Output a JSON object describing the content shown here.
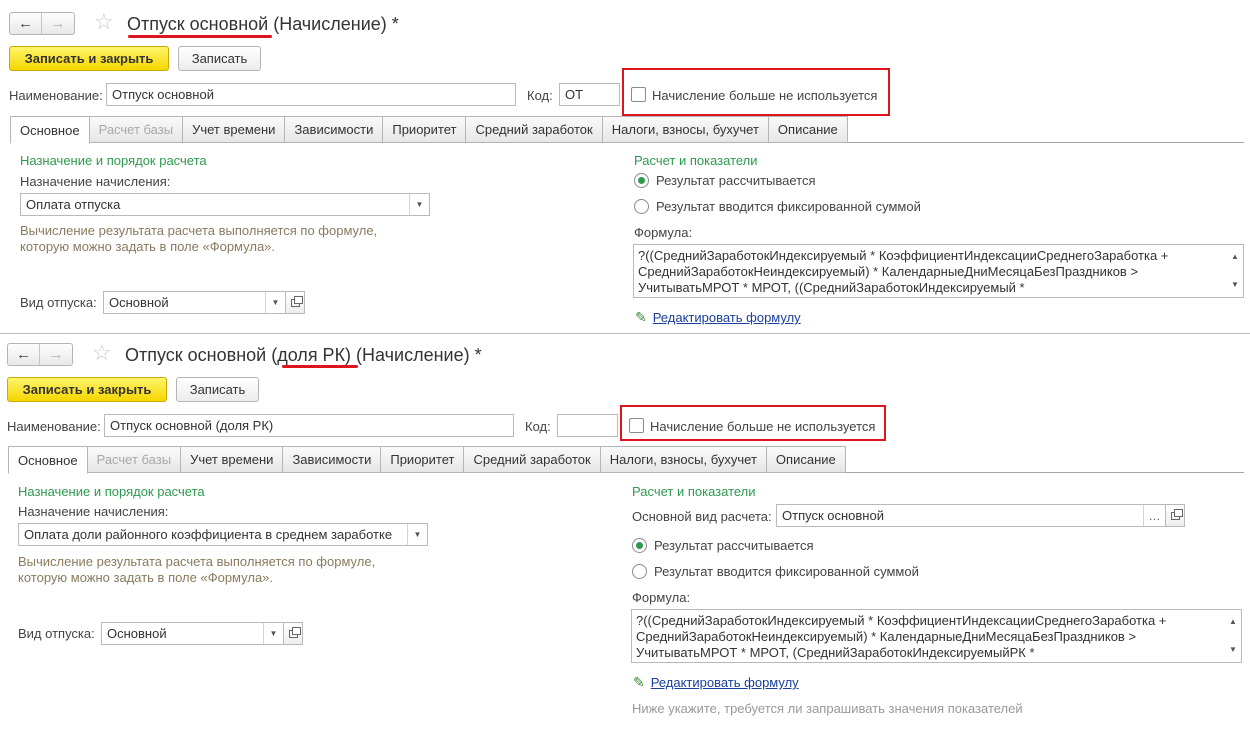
{
  "form1": {
    "title": "Отпуск основной (Начисление) *",
    "save_close": "Записать и закрыть",
    "save": "Записать",
    "name_label": "Наименование:",
    "name_value": "Отпуск основной",
    "code_label": "Код:",
    "code_value": "ОТ",
    "unused_label": "Начисление больше не используется",
    "tabs": [
      "Основное",
      "Расчет базы",
      "Учет времени",
      "Зависимости",
      "Приоритет",
      "Средний заработок",
      "Налоги, взносы, бухучет",
      "Описание"
    ],
    "section_left": "Назначение и порядок расчета",
    "purpose_label": "Назначение начисления:",
    "purpose_value": "Оплата отпуска",
    "note": "Вычисление результата расчета выполняется по формуле, которую можно задать в поле «Формула».",
    "vacation_label": "Вид отпуска:",
    "vacation_value": "Основной",
    "section_right": "Расчет и показатели",
    "radio_calc": "Результат рассчитывается",
    "radio_fixed": "Результат вводится фиксированной суммой",
    "formula_label": "Формула:",
    "formula_lines": [
      "?((СреднийЗаработокИндексируемый * КоэффициентИндексацииСреднегоЗаработка +",
      "СреднийЗаработокНеиндексируемый) * КалендарныеДниМесяцаБезПраздников >",
      "УчитыватьМРОТ * МРОТ, ((СреднийЗаработокИндексируемый *"
    ],
    "edit_formula": "Редактировать формулу"
  },
  "form2": {
    "title": "Отпуск основной (доля РК) (Начисление) *",
    "save_close": "Записать и закрыть",
    "save": "Записать",
    "name_label": "Наименование:",
    "name_value": "Отпуск основной (доля РК)",
    "code_label": "Код:",
    "code_value": "",
    "unused_label": "Начисление больше не используется",
    "tabs": [
      "Основное",
      "Расчет базы",
      "Учет времени",
      "Зависимости",
      "Приоритет",
      "Средний заработок",
      "Налоги, взносы, бухучет",
      "Описание"
    ],
    "section_left": "Назначение и порядок расчета",
    "purpose_label": "Назначение начисления:",
    "purpose_value": "Оплата доли районного коэффициента в среднем заработке",
    "note": "Вычисление результата расчета выполняется по формуле, которую можно задать в поле «Формула».",
    "vacation_label": "Вид отпуска:",
    "vacation_value": "Основной",
    "section_right": "Расчет и показатели",
    "base_type_label": "Основной вид расчета:",
    "base_type_value": "Отпуск основной",
    "radio_calc": "Результат рассчитывается",
    "radio_fixed": "Результат вводится фиксированной суммой",
    "formula_label": "Формула:",
    "formula_lines": [
      "?((СреднийЗаработокИндексируемый * КоэффициентИндексацииСреднегоЗаработка +",
      "СреднийЗаработокНеиндексируемый) * КалендарныеДниМесяцаБезПраздников >",
      "УчитыватьМРОТ * МРОТ, (СреднийЗаработокИндексируемыйРК *"
    ],
    "edit_formula": "Редактировать формулу",
    "hint": "Ниже укажите, требуется ли запрашивать значения показателей"
  },
  "colors": {
    "accent_green": "#2e9a4d",
    "highlight_red": "#e0141e",
    "primary_yellow": "#f5d600",
    "link_blue": "#1a3e9c"
  }
}
